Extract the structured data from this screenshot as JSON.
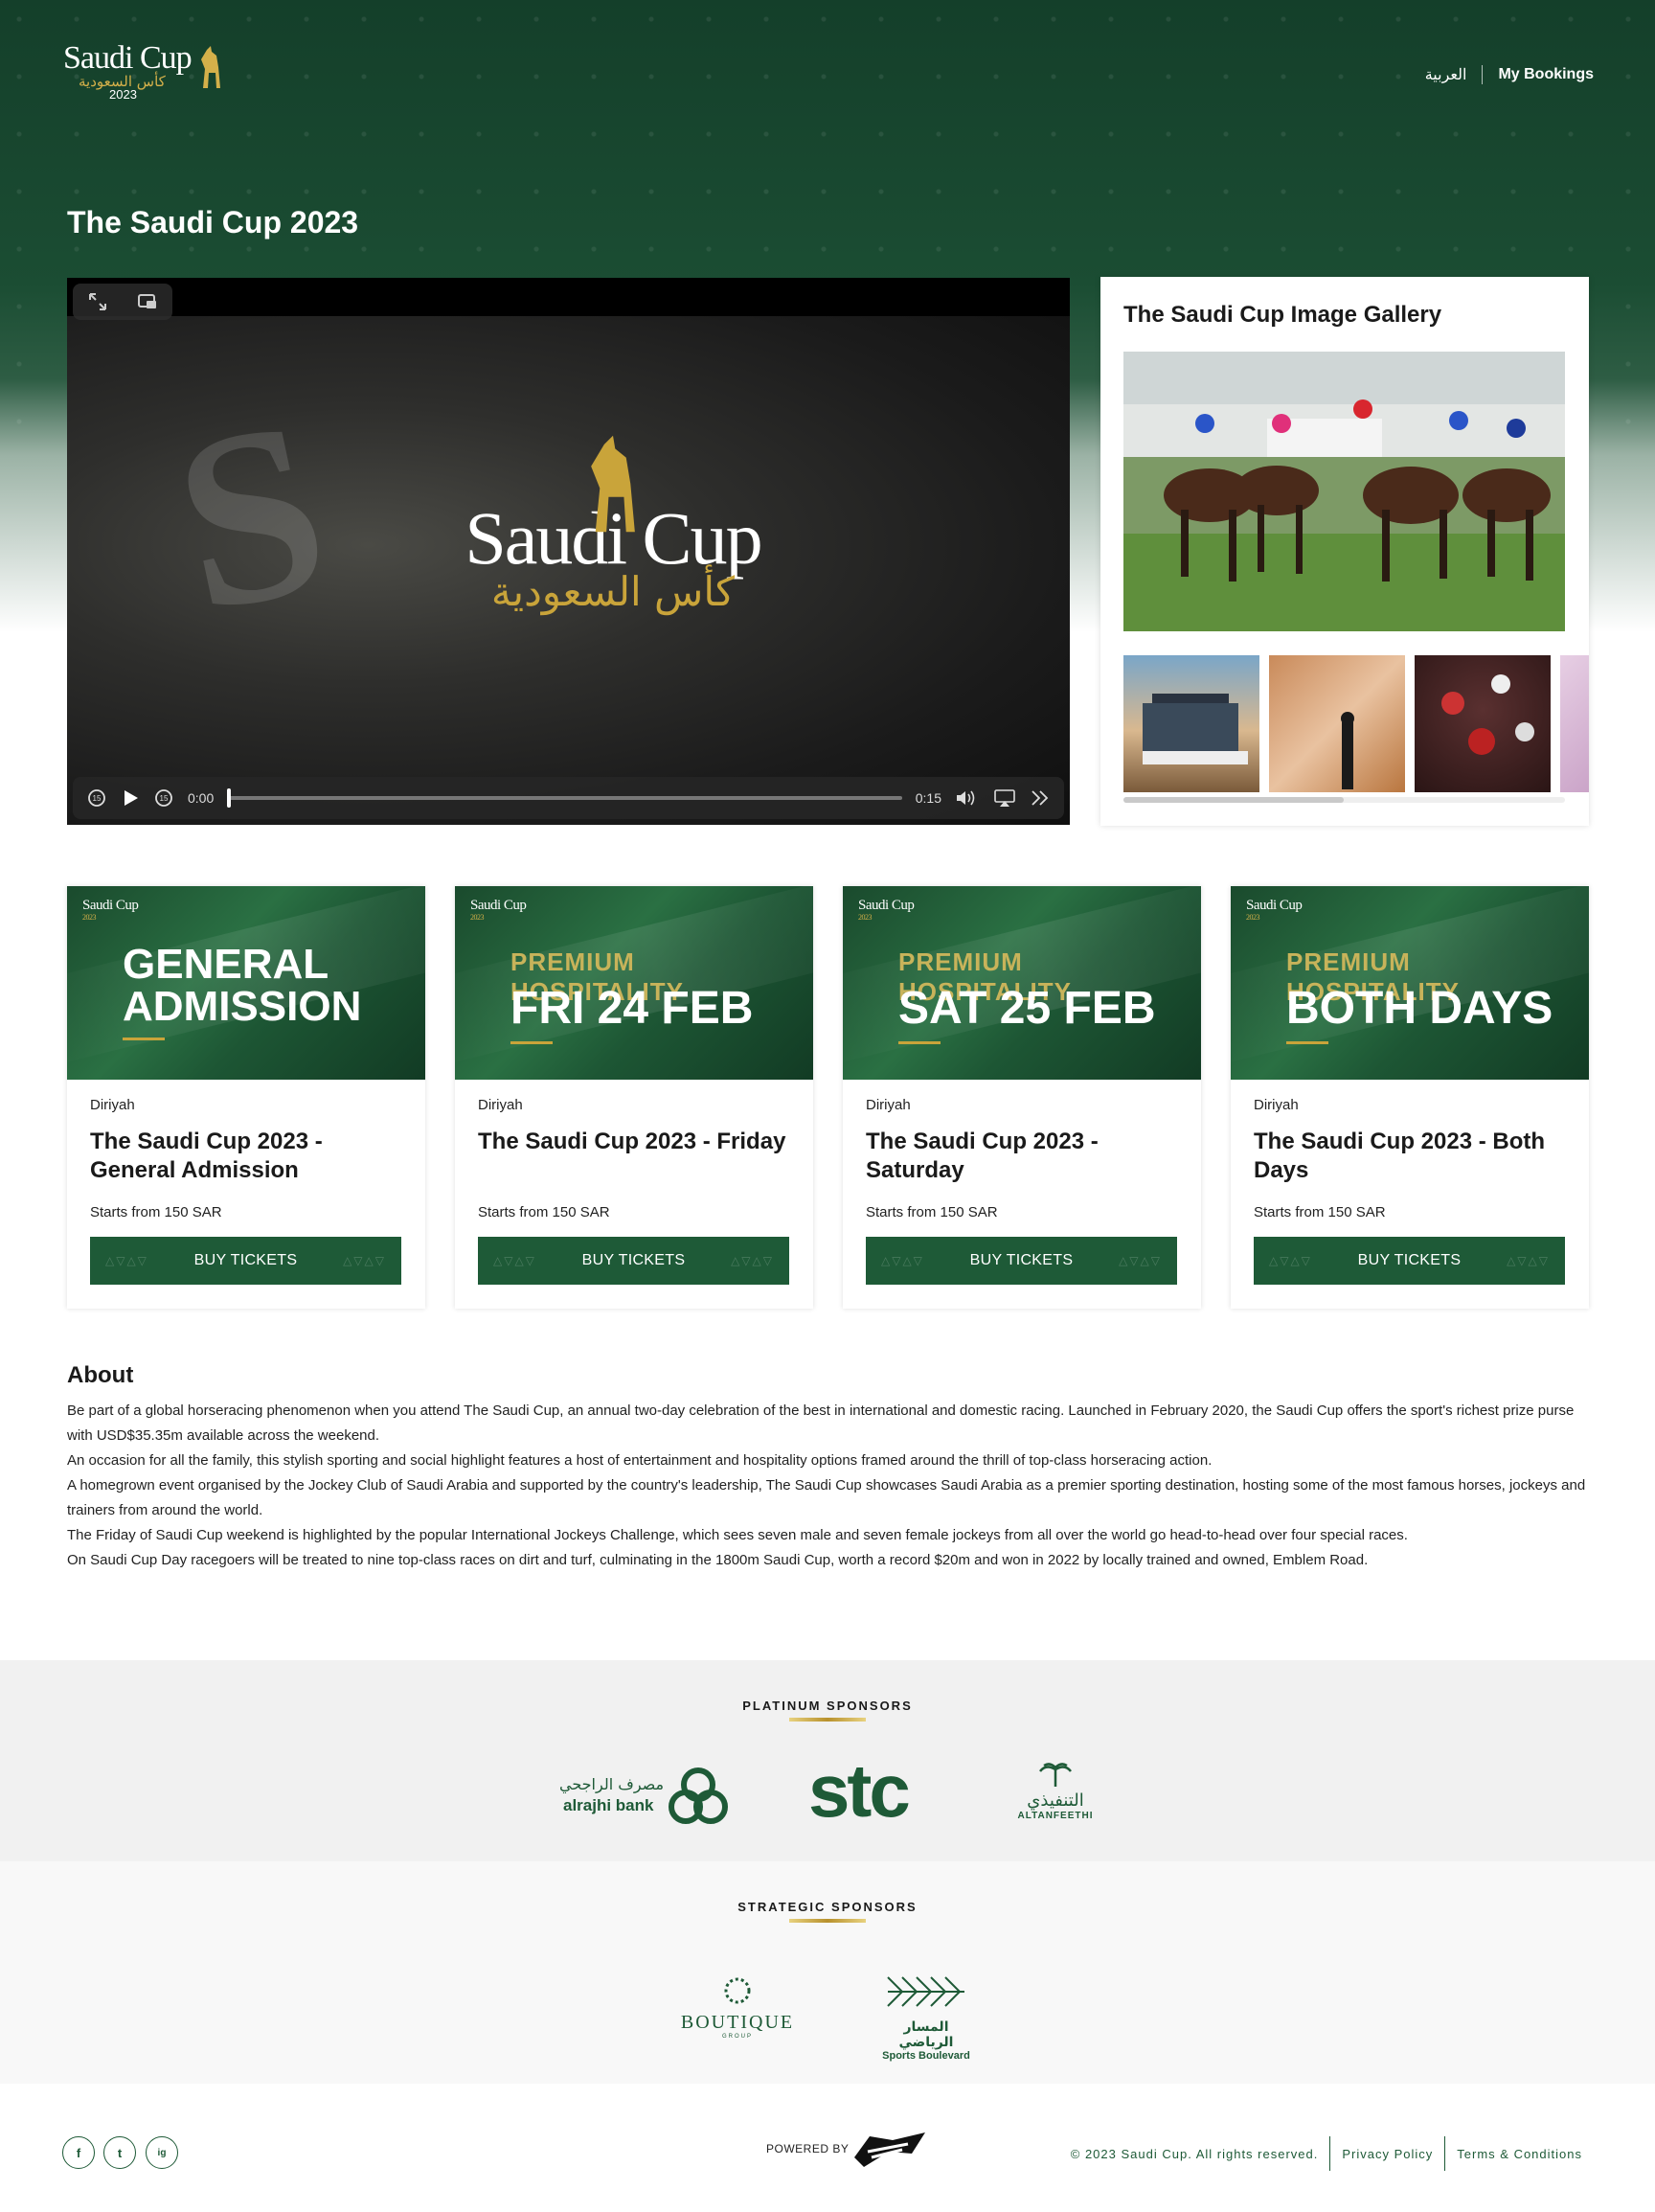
{
  "header": {
    "logo_text": "Saudi Cup",
    "logo_arabic": "كأس السعودية",
    "logo_year": "2023",
    "nav_arabic": "العربية",
    "nav_bookings": "My Bookings"
  },
  "page": {
    "title": "The Saudi Cup 2023"
  },
  "video": {
    "logo_text": "Saudi Cup",
    "logo_arabic": "كأس السعودية",
    "current_time": "0:00",
    "duration": "0:15",
    "progress": 0,
    "skip_back": "15",
    "skip_forward": "15"
  },
  "gallery": {
    "title": "The Saudi Cup Image Gallery"
  },
  "cards": [
    {
      "banner_line1": "",
      "banner_line2a": "GENERAL",
      "banner_line2b": "ADMISSION",
      "location": "Diriyah",
      "name": "The Saudi Cup 2023 - General Admission",
      "price": "Starts from 150 SAR",
      "button": "BUY TICKETS"
    },
    {
      "banner_line1": "PREMIUM HOSPITALITY",
      "banner_line2a": "FRI 24 FEB",
      "banner_line2b": "",
      "location": "Diriyah",
      "name": "The Saudi Cup 2023 - Friday",
      "price": "Starts from 150 SAR",
      "button": "BUY TICKETS"
    },
    {
      "banner_line1": "PREMIUM HOSPITALITY",
      "banner_line2a": "SAT 25 FEB",
      "banner_line2b": "",
      "location": "Diriyah",
      "name": "The Saudi Cup 2023 - Saturday",
      "price": "Starts from 150 SAR",
      "button": "BUY TICKETS"
    },
    {
      "banner_line1": "PREMIUM HOSPITALITY",
      "banner_line2a": "BOTH DAYS",
      "banner_line2b": "",
      "location": "Diriyah",
      "name": "The Saudi Cup 2023 - Both Days",
      "price": "Starts from 150 SAR",
      "button": "BUY TICKETS"
    }
  ],
  "card_banner_logo": "Saudi Cup",
  "card_banner_year": "2023",
  "about": {
    "title": "About",
    "p1": "Be part of a global horseracing phenomenon when you attend The Saudi Cup, an annual two-day celebration of the best in international and domestic racing. Launched in February 2020, the Saudi Cup offers the sport's richest prize purse with USD$35.35m available across the weekend.",
    "p2": "An occasion for all the family, this stylish sporting and social highlight features a host of entertainment and hospitality options framed around the thrill of top-class horseracing action.",
    "p3": "A homegrown event organised by the Jockey Club of Saudi Arabia and supported by the country's leadership, The Saudi Cup showcases Saudi Arabia as a premier sporting destination, hosting some of the most famous horses, jockeys and trainers from around the world.",
    "p4": "The Friday of Saudi Cup weekend is highlighted by the popular International Jockeys Challenge, which sees seven male and seven female jockeys from all over the world go head-to-head over four special races.",
    "p5": "On Saudi Cup Day racegoers will be treated to nine top-class races on dirt and turf, culminating in the 1800m Saudi Cup, worth a record $20m and won in 2022 by locally trained and owned, Emblem Road."
  },
  "sponsors": {
    "platinum_title": "PLATINUM SPONSORS",
    "strategic_title": "STRATEGIC SPONSORS",
    "alrajhi_ar": "مصرف الراجحي",
    "alrajhi_en": "alrajhi bank",
    "stc": "stc",
    "altanfeethi_ar": "التنفيذي",
    "altanfeethi_en": "ALTANFEETHI",
    "boutique": "BOUTIQUE",
    "boutique_sub": "GROUP",
    "boulevard_ar": "المسار الرياضي",
    "boulevard_en": "Sports Boulevard"
  },
  "footer": {
    "social": [
      "f",
      "t",
      "ig"
    ],
    "powered_by": "POWERED BY",
    "copyright": "© 2023 Saudi Cup. All rights reserved.",
    "privacy": "Privacy Policy",
    "terms": "Terms & Conditions"
  },
  "colors": {
    "brand_green": "#1e5a37",
    "gold": "#c9a43a",
    "hero_green": "#143f2a"
  }
}
